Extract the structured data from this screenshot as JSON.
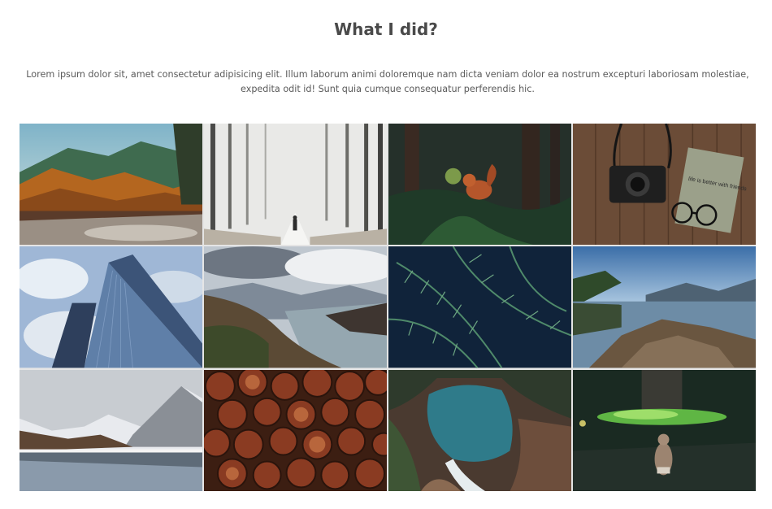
{
  "section": {
    "title": "What I did?",
    "description": "Lorem ipsum dolor sit, amet consectetur adipisicing elit. Illum laborum animi doloremque nam dicta veniam dolor ea nostrum excepturi laboriosam molestiae, expedita odit id! Sunt quia cumque consequatur perferendis hic."
  },
  "gallery": {
    "items": [
      {
        "name": "autumn-mountain-river-photo"
      },
      {
        "name": "foggy-forest-walker-photo"
      },
      {
        "name": "squirrel-forest-photo"
      },
      {
        "name": "camera-notebook-glasses-photo"
      },
      {
        "name": "glass-skyscraper-photo"
      },
      {
        "name": "mountain-valley-lake-photo"
      },
      {
        "name": "fern-leaves-photo"
      },
      {
        "name": "lake-rocky-shore-photo"
      },
      {
        "name": "snowy-mountain-lake-photo"
      },
      {
        "name": "log-pile-photo"
      },
      {
        "name": "canyon-river-aerial-photo"
      },
      {
        "name": "chipmunk-bokeh-photo"
      }
    ],
    "notebook_text": "life is better with friends"
  }
}
